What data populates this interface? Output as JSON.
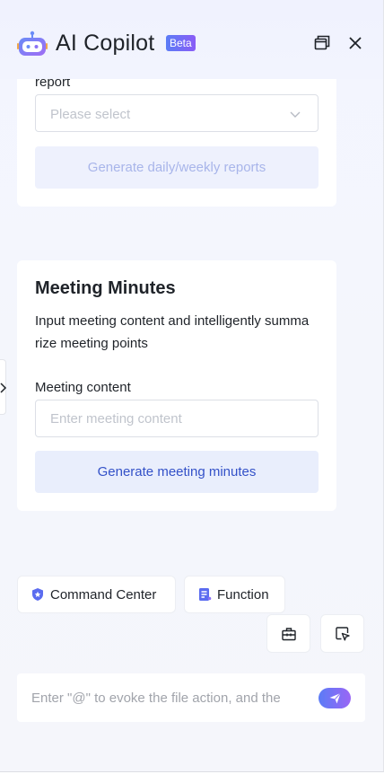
{
  "header": {
    "title": "AI Copilot",
    "badge": "Beta"
  },
  "report_card": {
    "field_label": "report",
    "select_placeholder": "Please select",
    "generate_label": "Generate daily/weekly reports"
  },
  "meeting_card": {
    "title": "Meeting Minutes",
    "description": "Input meeting content and intelligently summarize meeting points",
    "field_label": "Meeting content",
    "input_placeholder": "Enter meeting content",
    "generate_label": "Generate meeting minutes"
  },
  "chips": {
    "command_center": "Command Center",
    "function": "Function"
  },
  "composer": {
    "placeholder": "Enter \"@\" to evoke the file action, and the"
  },
  "icons": {
    "logo": "robot-logo-icon",
    "new_window": "new-window-icon",
    "close": "close-icon",
    "expand": "chevron-right-icon",
    "select_chevron": "chevron-down-icon",
    "command_center": "shield-star-icon",
    "function": "document-list-icon",
    "toolbox": "toolbox-icon",
    "pointer": "pointer-select-icon",
    "send": "send-icon"
  },
  "colors": {
    "accent": "#5b7cf6",
    "accent_purple": "#9a66f5",
    "button_text": "#3351c8"
  }
}
